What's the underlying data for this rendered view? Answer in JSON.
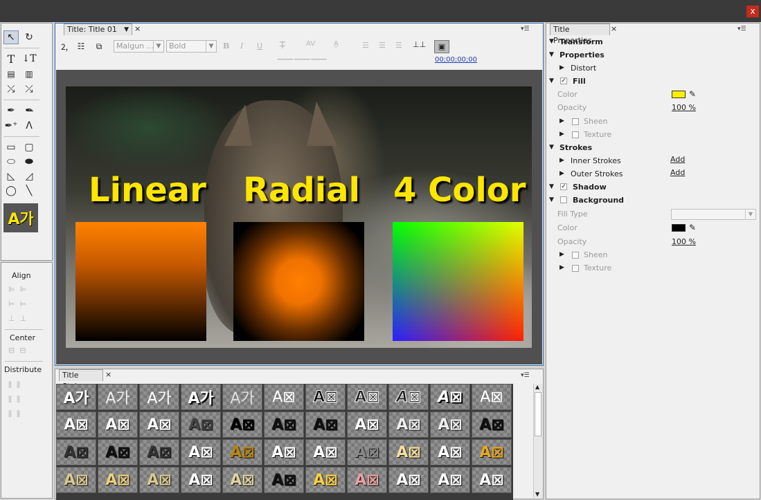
{
  "window": {
    "close_label": "x"
  },
  "title_panel": {
    "tab_label": "Title: Title 01",
    "font_family": "Malgun ...",
    "font_style": "Bold",
    "timecode": "00;00;00;00",
    "leading_placeholders": [
      "----------",
      "----------",
      "----------"
    ]
  },
  "canvas": {
    "labels": [
      "Linear",
      "Radial",
      "4 Color"
    ],
    "label_color": "#ffe600",
    "gradients": {
      "linear": [
        "#ff8200",
        "#000000"
      ],
      "radial": [
        "#ff8000",
        "#000000"
      ],
      "four_color": [
        "#00ff00",
        "#e6ff00",
        "#2020ff",
        "#ff2000"
      ]
    }
  },
  "tools": {
    "items": [
      "selection-tool",
      "rotation-tool",
      "type-tool",
      "vertical-type-tool",
      "area-type-tool",
      "vertical-area-type-tool",
      "path-type-tool",
      "vertical-path-type-tool",
      "pen-tool",
      "delete-anchor-tool",
      "add-anchor-tool",
      "convert-anchor-tool",
      "rectangle-tool",
      "rounded-corner-rectangle-tool",
      "clipped-corner-rectangle-tool",
      "rounded-rectangle-tool",
      "wedge-tool",
      "arc-tool",
      "ellipse-tool",
      "line-tool"
    ],
    "preview_text": "A가"
  },
  "actions": {
    "align_label": "Align",
    "center_label": "Center",
    "distribute_label": "Distribute"
  },
  "title_styles": {
    "tab_label": "Title Styles",
    "rows": [
      [
        "A가",
        "A가",
        "A가",
        "A가",
        "A가",
        "A⊠",
        "A⊠",
        "A⊠",
        "A⊠",
        "A⊠",
        "A⊠"
      ],
      [
        "A⊠",
        "A⊠",
        "A⊠",
        "A⊠",
        "A⊠",
        "A⊠",
        "A⊠",
        "A⊠",
        "A⊠",
        "A⊠",
        "A⊠"
      ],
      [
        "A⊠",
        "A⊠",
        "A⊠",
        "A⊠",
        "A⊠",
        "A⊠",
        "A⊠",
        "A⊠",
        "A⊠",
        "A⊠",
        "A⊠"
      ],
      [
        "A⊠",
        "A⊠",
        "A⊠",
        "A⊠",
        "A⊠",
        "A⊠",
        "A⊠",
        "A⊠",
        "A⊠",
        "A⊠",
        "A⊠"
      ]
    ]
  },
  "title_properties": {
    "tab_label": "Title Properties",
    "transform": "Transform",
    "properties": "Properties",
    "distort": "Distort",
    "fill": "Fill",
    "fill_color_label": "Color",
    "fill_color": "#ffee00",
    "fill_opacity_label": "Opacity",
    "fill_opacity": "100 %",
    "sheen": "Sheen",
    "texture": "Texture",
    "strokes": "Strokes",
    "inner_strokes": "Inner Strokes",
    "outer_strokes": "Outer Strokes",
    "add": "Add",
    "shadow": "Shadow",
    "background": "Background",
    "fill_type_label": "Fill Type",
    "bg_color_label": "Color",
    "bg_color": "#000000",
    "bg_opacity_label": "Opacity",
    "bg_opacity": "100 %"
  }
}
